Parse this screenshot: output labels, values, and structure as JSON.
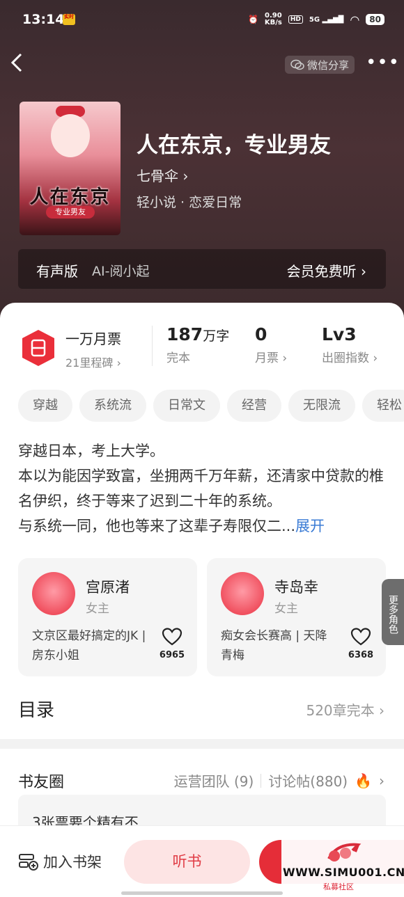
{
  "status_bar": {
    "time": "13:14",
    "app_badge": "实时",
    "net_speed": "0.90",
    "net_unit": "KB/s",
    "hd": "HD",
    "signal": "5G",
    "battery": "80"
  },
  "nav": {
    "share_label": "微信分享",
    "more_label": "•••",
    "back_label": "‹"
  },
  "book": {
    "cover_title": "人在东京",
    "cover_subtitle": "专业男友",
    "title": "人在东京，专业男友",
    "author": "七骨伞 ›",
    "genre": "轻小说 · 恋爱日常"
  },
  "audio": {
    "label": "有声版",
    "narrator": "AI-阅小起",
    "action": "会员免费听 ›"
  },
  "stats": {
    "rank_value": "一万月票",
    "rank_sub": "21里程碑 ›",
    "words_value": "187",
    "words_unit": "万字",
    "words_sub": "完本",
    "tickets_value": "0",
    "tickets_sub": "月票 ›",
    "level_value": "Lv3",
    "level_sub": "出圈指数 ›"
  },
  "tags": [
    "穿越",
    "系统流",
    "日常文",
    "经营",
    "无限流",
    "轻松"
  ],
  "synopsis": {
    "line1": "穿越日本，考上大学。",
    "line2": "本以为能因学致富，坐拥两千万年薪，还清家中贷款的椎名伊织，终于等来了迟到二十年的系统。",
    "line3": "与系统一同，他也等来了这辈子寿限仅二...",
    "expand": "展开"
  },
  "characters": [
    {
      "name": "宫原渚",
      "role": "女主",
      "desc": "文京区最好搞定的JK | 房东小姐",
      "likes": "6965"
    },
    {
      "name": "寺岛幸",
      "role": "女主",
      "desc": "痴女会长赛高 | 天降青梅",
      "likes": "6368"
    }
  ],
  "more_roles": "更多角色",
  "toc": {
    "title": "目录",
    "info": "520章完本 ›"
  },
  "circle": {
    "title": "书友圈",
    "team": "运营团队 (9)",
    "posts": "讨论帖(880)",
    "first_post": "3张票要个精有不"
  },
  "bottom": {
    "shelf": "加入书架",
    "listen": "听书"
  },
  "watermark": {
    "site": "WWW.SIMU001.CN",
    "sub": "私募社区"
  },
  "colors": {
    "accent": "#e52d38",
    "link": "#3a7bd5",
    "hero_bg": "#4b3135"
  }
}
